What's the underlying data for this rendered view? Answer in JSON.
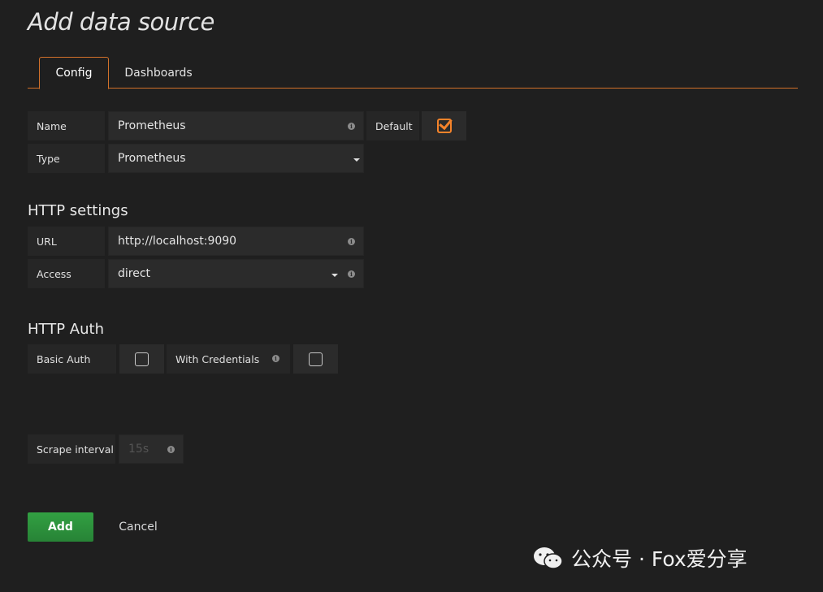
{
  "page": {
    "title": "Add data source"
  },
  "tabs": [
    {
      "label": "Config"
    },
    {
      "label": "Dashboards"
    }
  ],
  "form": {
    "name": {
      "label": "Name",
      "value": "Prometheus"
    },
    "default": {
      "label": "Default",
      "checked": true
    },
    "type": {
      "label": "Type",
      "value": "Prometheus"
    }
  },
  "http_settings": {
    "title": "HTTP settings",
    "url": {
      "label": "URL",
      "value": "http://localhost:9090"
    },
    "access": {
      "label": "Access",
      "value": "direct"
    }
  },
  "http_auth": {
    "title": "HTTP Auth",
    "basic_auth": {
      "label": "Basic Auth",
      "checked": false
    },
    "with_credentials": {
      "label": "With Credentials",
      "checked": false
    }
  },
  "scrape": {
    "label": "Scrape interval",
    "placeholder": "15s"
  },
  "actions": {
    "add_label": "Add",
    "cancel_label": "Cancel"
  },
  "watermark": {
    "text": "公众号 · Fox爱分享"
  },
  "colors": {
    "accent": "#f5832a",
    "success": "#299c46",
    "background": "#1f1f1f"
  }
}
